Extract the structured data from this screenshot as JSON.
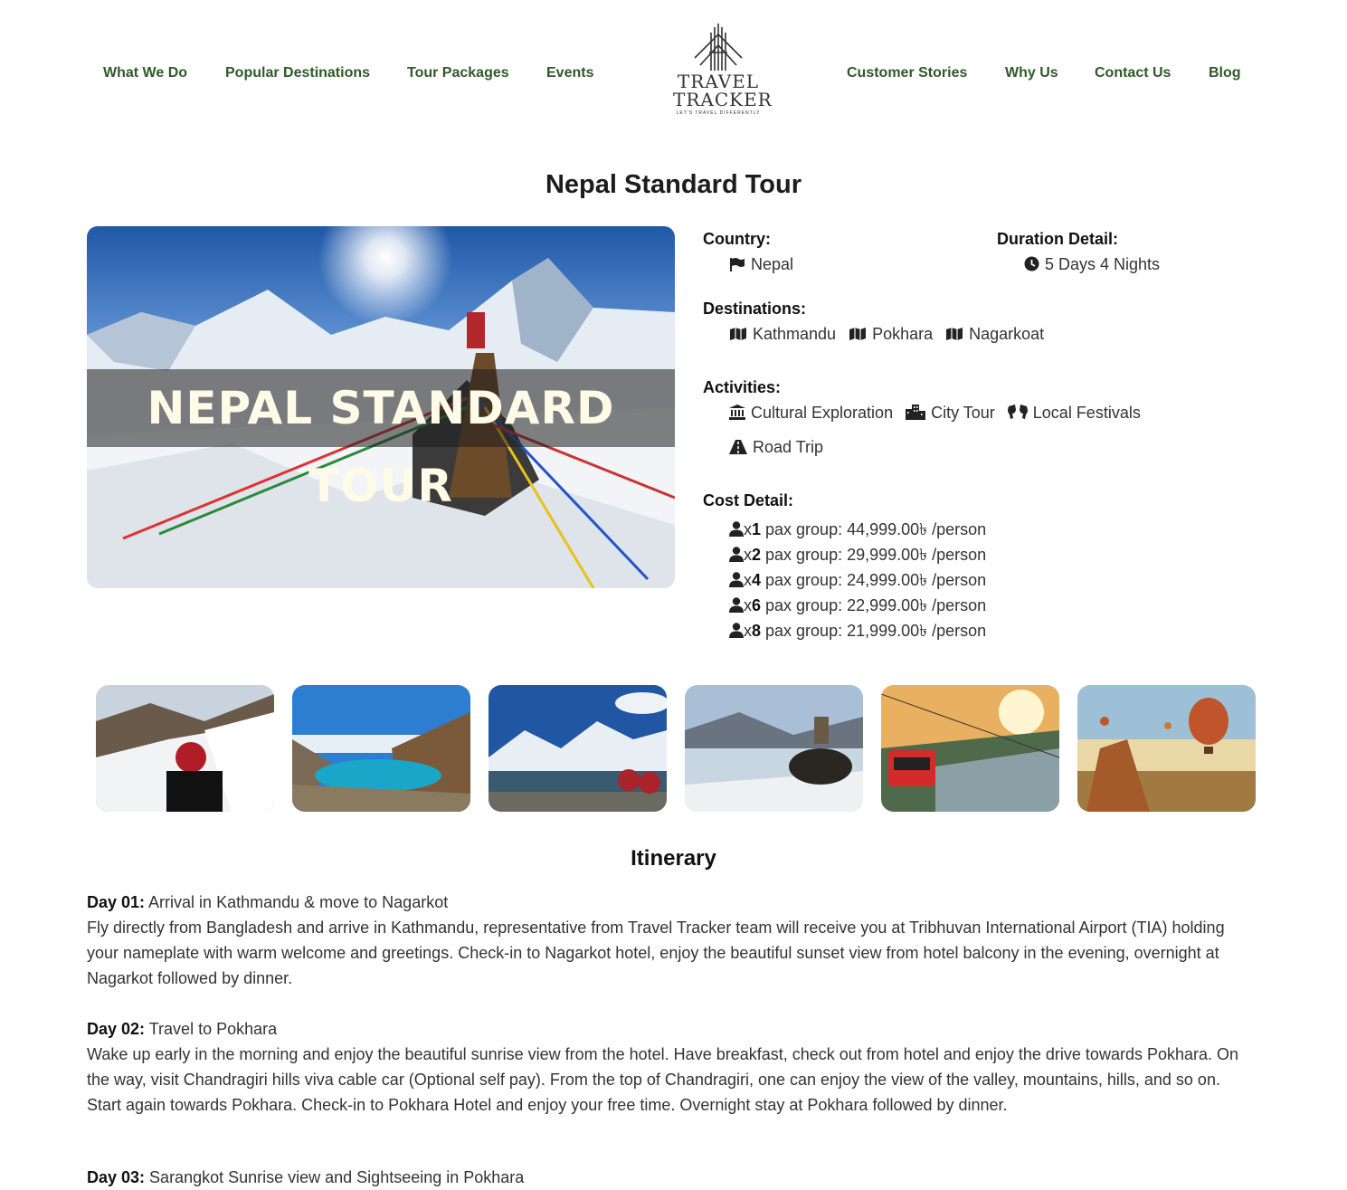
{
  "nav": {
    "left": [
      "What We Do",
      "Popular Destinations",
      "Tour Packages",
      "Events"
    ],
    "right": [
      "Customer Stories",
      "Why Us",
      "Contact Us",
      "Blog"
    ]
  },
  "logo": {
    "line1": "TRAVEL",
    "line2": "TRACKER",
    "tagline": "LET'S TRAVEL DIFFERENTLY"
  },
  "page_title": "Nepal Standard Tour",
  "hero": {
    "overlay_text": "NEPAL STANDARD TOUR"
  },
  "details": {
    "country_label": "Country:",
    "country": "Nepal",
    "duration_label": "Duration Detail:",
    "duration": "5 Days 4 Nights",
    "destinations_label": "Destinations:",
    "destinations": [
      "Kathmandu",
      "Pokhara",
      "Nagarkoat"
    ],
    "activities_label": "Activities:",
    "activities": [
      "Cultural Exploration",
      "City Tour",
      "Local Festivals",
      "Road Trip"
    ],
    "cost_label": "Cost Detail:",
    "costs": [
      {
        "x": "x",
        "n": "1",
        "text": " pax group: 44,999.00৳ /person"
      },
      {
        "x": "x",
        "n": "2",
        "text": " pax group: 29,999.00৳ /person"
      },
      {
        "x": "x",
        "n": "4",
        "text": " pax group: 24,999.00৳ /person"
      },
      {
        "x": "x",
        "n": "6",
        "text": " pax group: 22,999.00৳ /person"
      },
      {
        "x": "x",
        "n": "8",
        "text": " pax group: 21,999.00৳ /person"
      }
    ]
  },
  "itinerary": {
    "heading": "Itinerary",
    "days": [
      {
        "label": "Day 01:",
        "title": " Arrival in Kathmandu & move to Nagarkot",
        "body": "Fly directly from Bangladesh and arrive in Kathmandu, representative from Travel Tracker team will receive you at Tribhuvan International Airport (TIA) holding your nameplate with warm welcome and greetings. Check-in to Nagarkot hotel, enjoy the beautiful sunset view from hotel balcony in the evening, overnight at Nagarkot followed by dinner."
      },
      {
        "label": "Day 02:",
        "title": " Travel to Pokhara",
        "body": "Wake up early in the morning and enjoy the beautiful sunrise view from the hotel. Have breakfast, check out from hotel and enjoy the drive towards Pokhara. On the way, visit Chandragiri hills viva cable car (Optional self pay). From the top of Chandragiri, one can enjoy the view of the valley, mountains, hills, and so on. Start again towards  Pokhara. Check-in to Pokhara Hotel and enjoy your free time. Overnight stay at Pokhara followed by dinner."
      },
      {
        "label": "Day 03:",
        "title": " Sarangkot Sunrise view and Sightseeing in Pokhara",
        "body": ""
      }
    ]
  },
  "colors": {
    "nav_link": "#2f5a29",
    "text": "#333333"
  }
}
